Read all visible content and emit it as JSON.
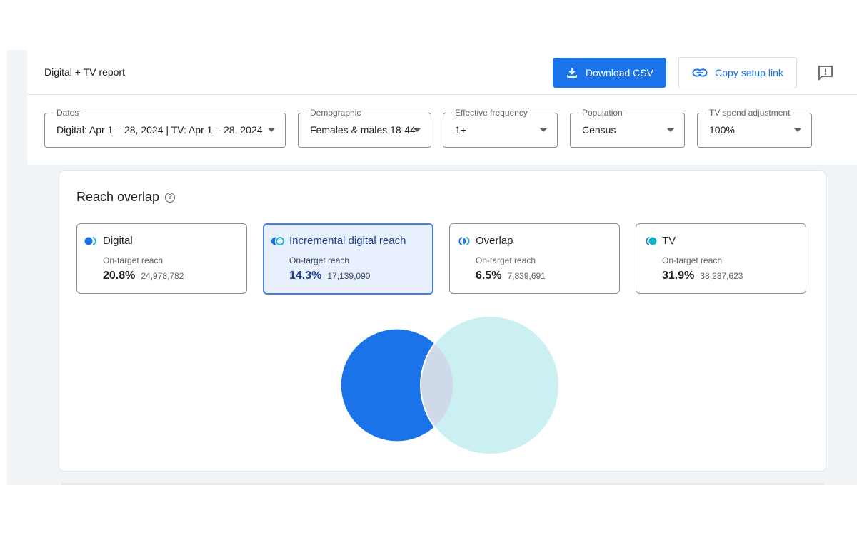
{
  "header": {
    "title": "Digital + TV report",
    "download_label": "Download CSV",
    "download_icon": "download-icon",
    "copy_label": "Copy setup link",
    "copy_icon": "link-icon",
    "feedback_icon": "feedback-icon"
  },
  "filters": [
    {
      "label": "Dates",
      "value": "Digital: Apr 1 – 28, 2024 | TV: Apr 1 – 28, 2024"
    },
    {
      "label": "Demographic",
      "value": "Females & males 18-44"
    },
    {
      "label": "Effective frequency",
      "value": "1+"
    },
    {
      "label": "Population",
      "value": "Census"
    },
    {
      "label": "TV spend adjustment",
      "value": "100%"
    }
  ],
  "reach_overlap": {
    "title": "Reach overlap",
    "help_icon": "?",
    "metrics": [
      {
        "name": "Digital",
        "sub": "On-target reach",
        "pct": "20.8%",
        "count": "24,978,782",
        "selected": false,
        "icon": "digital-icon"
      },
      {
        "name": "Incremental digital reach",
        "sub": "On-target reach",
        "pct": "14.3%",
        "count": "17,139,090",
        "selected": true,
        "icon": "incremental-icon"
      },
      {
        "name": "Overlap",
        "sub": "On-target reach",
        "pct": "6.5%",
        "count": "7,839,691",
        "selected": false,
        "icon": "overlap-icon"
      },
      {
        "name": "TV",
        "sub": "On-target reach",
        "pct": "31.9%",
        "count": "38,237,623",
        "selected": false,
        "icon": "tv-icon"
      }
    ],
    "venn": {
      "digital_pct": 20.8,
      "tv_pct": 31.9,
      "overlap_pct": 6.5,
      "colors": {
        "digital": "#1a73e8",
        "tv": "#cbf0f2",
        "overlap": "#cfd9ea"
      }
    }
  }
}
